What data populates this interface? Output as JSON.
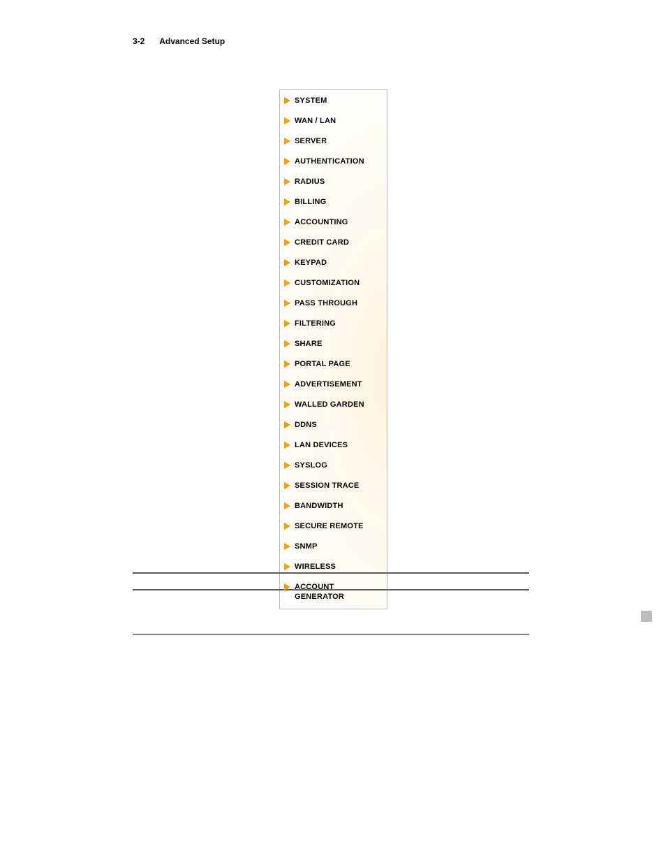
{
  "header": {
    "page_number": "3-2",
    "title": "Advanced Setup"
  },
  "menu": {
    "items": [
      {
        "label": "SYSTEM"
      },
      {
        "label": "WAN / LAN"
      },
      {
        "label": "SERVER"
      },
      {
        "label": "AUTHENTICATION"
      },
      {
        "label": "RADIUS"
      },
      {
        "label": "BILLING"
      },
      {
        "label": "ACCOUNTING"
      },
      {
        "label": "CREDIT CARD"
      },
      {
        "label": "KEYPAD"
      },
      {
        "label": "CUSTOMIZATION"
      },
      {
        "label": "PASS THROUGH"
      },
      {
        "label": "FILTERING"
      },
      {
        "label": "SHARE"
      },
      {
        "label": "PORTAL PAGE"
      },
      {
        "label": "ADVERTISEMENT"
      },
      {
        "label": "WALLED GARDEN"
      },
      {
        "label": "DDNS"
      },
      {
        "label": "LAN DEVICES"
      },
      {
        "label": "SYSLOG"
      },
      {
        "label": "SESSION TRACE"
      },
      {
        "label": "BANDWIDTH"
      },
      {
        "label": "SECURE REMOTE"
      },
      {
        "label": "SNMP"
      },
      {
        "label": "WIRELESS"
      },
      {
        "label": "ACCOUNT GENERATOR"
      }
    ]
  }
}
